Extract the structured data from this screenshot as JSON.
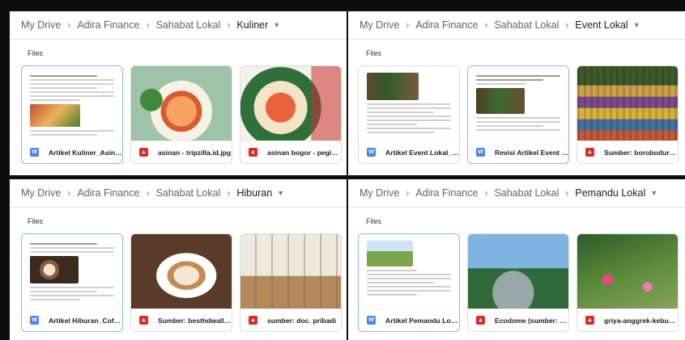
{
  "panels": [
    {
      "breadcrumb": [
        "My Drive",
        "Adira Finance",
        "Sahabat Lokal",
        "Kuliner"
      ],
      "section_label": "Files",
      "files": [
        {
          "name": "Artikel Kuliner_Asinan ...",
          "type": "doc",
          "selected": true
        },
        {
          "name": "asinan - tripzilla.id.jpg",
          "type": "image",
          "selected": false
        },
        {
          "name": "asinan bogor - pegipeg...",
          "type": "image",
          "selected": false
        }
      ]
    },
    {
      "breadcrumb": [
        "My Drive",
        "Adira Finance",
        "Sahabat Lokal",
        "Event Lokal"
      ],
      "section_label": "Files",
      "files": [
        {
          "name": "Artikel Event Lokal_Cu...",
          "type": "doc",
          "selected": false
        },
        {
          "name": "Revisi Artikel Event Lo...",
          "type": "doc",
          "selected": true
        },
        {
          "name": "Sumber: borobudurne...",
          "type": "image",
          "selected": false
        }
      ]
    },
    {
      "breadcrumb": [
        "My Drive",
        "Adira Finance",
        "Sahabat Lokal",
        "Hiburan"
      ],
      "section_label": "Files",
      "files": [
        {
          "name": "Artikel Hiburan_Coffee ...",
          "type": "doc",
          "selected": true
        },
        {
          "name": "Sumber: besthdwallpa...",
          "type": "image",
          "selected": false
        },
        {
          "name": "sumber: doc. pribadi",
          "type": "image",
          "selected": false
        }
      ]
    },
    {
      "breadcrumb": [
        "My Drive",
        "Adira Finance",
        "Sahabat Lokal",
        "Pemandu Lokal"
      ],
      "section_label": "Files",
      "files": [
        {
          "name": "Artikel Pemandu Lokal...",
          "type": "doc",
          "selected": true
        },
        {
          "name": "Ecodome (sumber: keb...",
          "type": "image",
          "selected": false
        },
        {
          "name": "griya-anggrek-kebun-ra...",
          "type": "image",
          "selected": false
        }
      ]
    }
  ],
  "icons": {
    "doc": "google-docs-icon",
    "image": "image-file-icon",
    "separator": "chevron-right-icon",
    "dropdown": "caret-down-icon"
  },
  "colors": {
    "doc_icon": "#4a86e8",
    "image_icon": "#d93025",
    "selected_border": "#8ab4f8"
  }
}
